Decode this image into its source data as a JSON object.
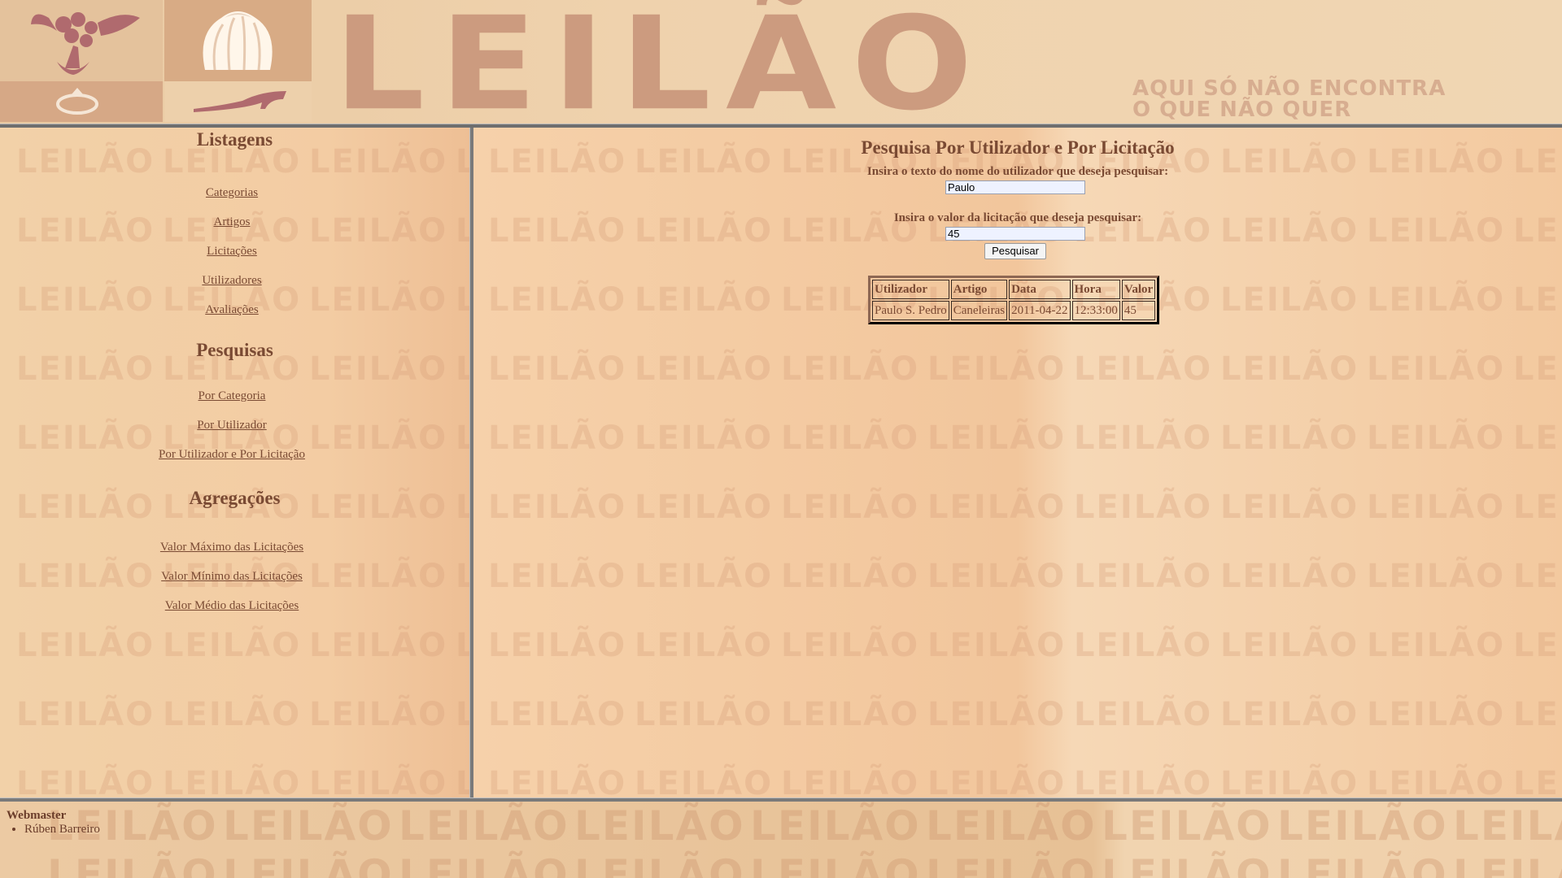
{
  "header": {
    "logo_text": "LEILÃO",
    "tagline_line1": "AQUI SÓ NÃO ENCONTRA",
    "tagline_line2": "O QUE NÃO QUER"
  },
  "sidebar": {
    "listagens_heading": "Listagens",
    "listagens": [
      "Categorias",
      "Artigos",
      "Licitações",
      "Utilizadores",
      "Avaliações"
    ],
    "pesquisas_heading": "Pesquisas",
    "pesquisas": [
      "Por Categoria",
      "Por Utilizador",
      "Por Utilizador e Por Licitação"
    ],
    "agregacoes_heading": "Agregações",
    "agregacoes": [
      "Valor Máximo das Licitações",
      "Valor Mínimo das Licitações",
      "Valor Médio das Licitações"
    ]
  },
  "main": {
    "title": "Pesquisa Por Utilizador e Por Licitação",
    "name_label": "Insira o texto do nome do utilizador que deseja pesquisar:",
    "name_value": "Paulo",
    "value_label": "Insira o valor da licitação que deseja pesquisar:",
    "value_value": "45",
    "search_button": "Pesquisar",
    "table": {
      "headers": [
        "Utilizador",
        "Artigo",
        "Data",
        "Hora",
        "Valor"
      ],
      "rows": [
        [
          "Paulo S. Pedro",
          "Caneleiras",
          "2011-04-22",
          "12:33:00",
          "45"
        ]
      ]
    }
  },
  "footer": {
    "title": "Webmaster",
    "names": [
      "Rúben Barreiro"
    ]
  },
  "watermark": "LEILÃO",
  "colors": {
    "text": "#7a4a33",
    "background": "#f1cda5",
    "header_logo": "#cc9b7f"
  }
}
